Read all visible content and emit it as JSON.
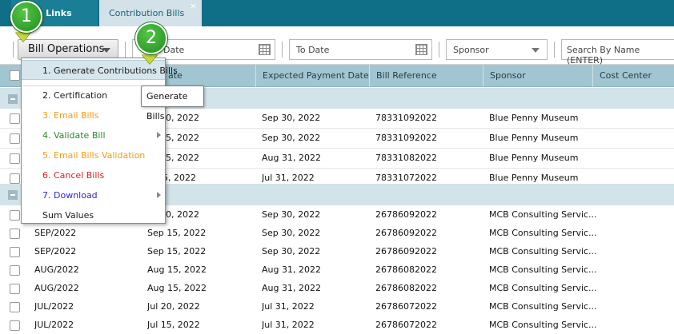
{
  "tabs": [
    {
      "label": "bers Links"
    },
    {
      "label": "Contribution Bills",
      "close": "×"
    }
  ],
  "toolbar": {
    "bill_operations_label": "Bill Operations",
    "from_date_placeholder": "Date",
    "to_date_placeholder": "To Date",
    "sponsor_placeholder": "Sponsor",
    "search_placeholder": "Search By Name (ENTER)"
  },
  "grid": {
    "headers": {
      "bill_date": "ate",
      "expected_payment_date": "Expected Payment Date",
      "bill_reference": "Bill Reference",
      "sponsor": "Sponsor",
      "cost_center": "Cost Center"
    },
    "rows": [
      {
        "period": "",
        "bill_date": "30, 2022",
        "expected": "Sep 30, 2022",
        "reference": "78331092022",
        "sponsor": "Blue Penny Museum"
      },
      {
        "period": "",
        "bill_date": "15, 2022",
        "expected": "Sep 30, 2022",
        "reference": "78331092022",
        "sponsor": "Blue Penny Museum"
      },
      {
        "period": "",
        "bill_date": "15, 2022",
        "expected": "Aug 31, 2022",
        "reference": "78331082022",
        "sponsor": "Blue Penny Museum"
      },
      {
        "period": "",
        "bill_date": "5, 2022",
        "expected": "Jul 31, 2022",
        "reference": "78331072022",
        "sponsor": "Blue Penny Museum"
      },
      {
        "period": "",
        "bill_date": "30, 2022",
        "expected": "Sep 30, 2022",
        "reference": "26786092022",
        "sponsor": "MCB Consulting Servic..."
      },
      {
        "period": "SEP/2022",
        "bill_date": "Sep 15, 2022",
        "expected": "Sep 30, 2022",
        "reference": "26786092022",
        "sponsor": "MCB Consulting Servic..."
      },
      {
        "period": "SEP/2022",
        "bill_date": "Sep 15, 2022",
        "expected": "Sep 30, 2022",
        "reference": "26786092022",
        "sponsor": "MCB Consulting Servic..."
      },
      {
        "period": "AUG/2022",
        "bill_date": "Aug 15, 2022",
        "expected": "Aug 31, 2022",
        "reference": "26786082022",
        "sponsor": "MCB Consulting Servic..."
      },
      {
        "period": "AUG/2022",
        "bill_date": "Aug 15, 2022",
        "expected": "Aug 31, 2022",
        "reference": "26786082022",
        "sponsor": "MCB Consulting Servic..."
      },
      {
        "period": "JUL/2022",
        "bill_date": "Jul 20, 2022",
        "expected": "Jul 31, 2022",
        "reference": "26786072022",
        "sponsor": "MCB Consulting Servic..."
      },
      {
        "period": "JUL/2022",
        "bill_date": "Jul 15, 2022",
        "expected": "Jul 31, 2022",
        "reference": "26786072022",
        "sponsor": "MCB Consulting Servic..."
      }
    ]
  },
  "menu": {
    "items": [
      {
        "label": "1. Generate Contributions Bills",
        "color": "#1a1a1a"
      },
      {
        "label": "2. Certification",
        "color": "#1a1a1a"
      },
      {
        "label": "3. Email Bills",
        "color": "#f39c12"
      },
      {
        "label": "4. Validate Bill",
        "color": "#2a8a2a"
      },
      {
        "label": "5. Email Bills Validation",
        "color": "#f39c12"
      },
      {
        "label": "6. Cancel Bills",
        "color": "#e02020"
      },
      {
        "label": "7. Download",
        "color": "#2a2ad0"
      },
      {
        "label": "Sum Values",
        "color": "#1a1a1a"
      }
    ]
  },
  "tooltip": {
    "text": "Generate Bills"
  },
  "badges": {
    "one": "1",
    "two": "2"
  },
  "colors": {
    "tabbar": "#0f6f86",
    "header": "#a2c6d1",
    "group_row": "#d2e3e9",
    "badge": "#2ea82e"
  }
}
